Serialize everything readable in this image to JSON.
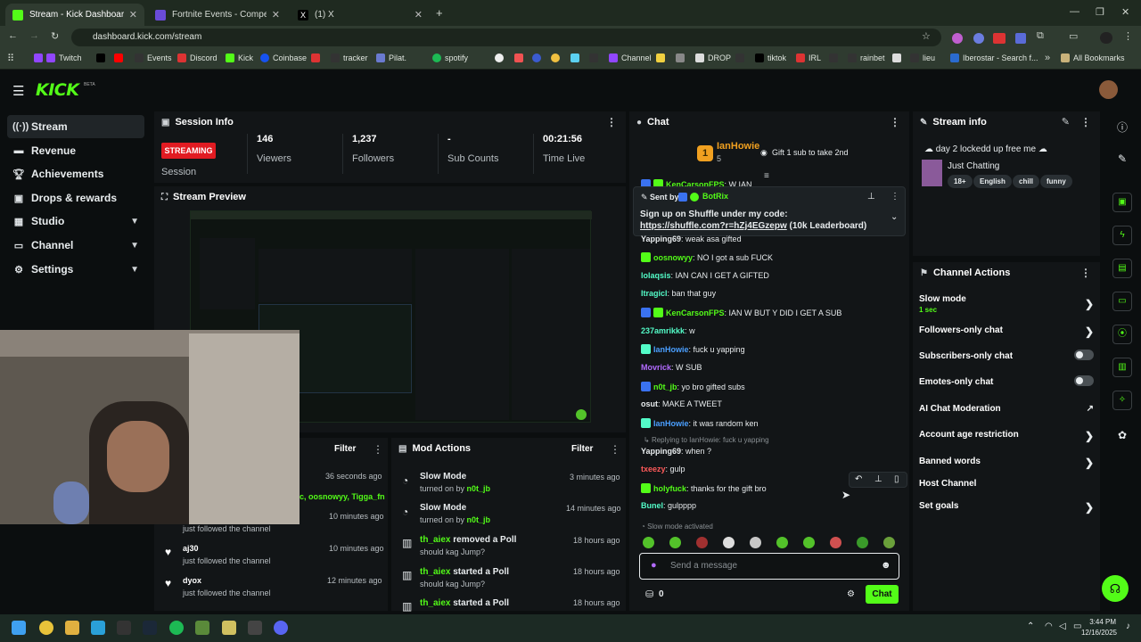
{
  "browser": {
    "tabs": [
      {
        "title": "Stream - Kick Dashboard",
        "color": "#53fc18"
      },
      {
        "title": "Fortnite Events - Competitive Tr",
        "color": "#6a4bd8"
      },
      {
        "title": "(1) X",
        "color": "#000000"
      }
    ],
    "url": "dashboard.kick.com/stream",
    "bookmarks": [
      "Twitch",
      "Events",
      "Discord",
      "Kick",
      "Coinbase",
      "tracker",
      "Pilat.",
      "spotify",
      "Channel",
      "DROP",
      "tiktok",
      "IRL",
      "rainbet",
      "lieu",
      "Iberostar - Search f...",
      "All Bookmarks"
    ]
  },
  "brand": {
    "logo": "KICK",
    "beta": "BETA",
    "accent": "#53fc18"
  },
  "sidebar": {
    "items": [
      {
        "label": "Stream",
        "icon": "broadcast-icon"
      },
      {
        "label": "Revenue",
        "icon": "wallet-icon"
      },
      {
        "label": "Achievements",
        "icon": "trophy-icon"
      },
      {
        "label": "Drops & rewards",
        "icon": "gift-icon"
      },
      {
        "label": "Studio",
        "icon": "studio-icon"
      },
      {
        "label": "Channel",
        "icon": "channel-icon"
      },
      {
        "label": "Settings",
        "icon": "gear-icon"
      }
    ]
  },
  "session": {
    "title": "Session Info",
    "status": "STREAMING",
    "status_label": "Session",
    "stats": [
      {
        "value": "146",
        "label": "Viewers"
      },
      {
        "value": "1,237",
        "label": "Followers"
      },
      {
        "value": "-",
        "label": "Sub Counts"
      },
      {
        "value": "00:21:56",
        "label": "Time Live"
      }
    ]
  },
  "preview": {
    "title": "Stream Preview"
  },
  "activity": {
    "filter": "Filter",
    "first_time": "36 seconds ago",
    "first_names": "c, oosnowyy, Tigga_fn",
    "items": [
      {
        "user": "",
        "action": "just followed the channel",
        "time": "10 minutes ago"
      },
      {
        "user": "aj30",
        "action": "just followed the channel",
        "time": "10 minutes ago"
      },
      {
        "user": "dyox",
        "action": "just followed the channel",
        "time": "12 minutes ago"
      }
    ]
  },
  "modactions": {
    "title": "Mod Actions",
    "filter": "Filter",
    "items": [
      {
        "title": "Slow Mode",
        "sub_prefix": "turned on by ",
        "sub_user": "n0t_jb",
        "time": "3 minutes ago"
      },
      {
        "title": "Slow Mode",
        "sub_prefix": "turned on by ",
        "sub_user": "n0t_jb",
        "time": "14 minutes ago"
      },
      {
        "title_user": "th_aiex",
        "title_rest": " removed a Poll",
        "sub": "should kag Jump?",
        "time": "18 hours ago"
      },
      {
        "title_user": "th_aiex",
        "title_rest": " started a Poll",
        "sub": "should kag Jump?",
        "time": "18 hours ago"
      },
      {
        "title_user": "th_aiex",
        "title_rest": " started a Poll",
        "sub": "",
        "time": "18 hours ago"
      }
    ]
  },
  "chat": {
    "title": "Chat",
    "top_gifter": "IanHowie",
    "top_rank": "1",
    "top_count": "5",
    "gift_msg": "Gift 1 sub to take 2nd",
    "pinned": {
      "sent_by": "Sent by",
      "user": "BotRix",
      "text": "Sign up on Shuffle under my code: ",
      "link": "https://shuffle.com?r=hZj4EGzepw",
      "suffix": " (10k Leaderboard)"
    },
    "messages": [
      {
        "user": "KenCarsonFPS",
        "text": "W IAN",
        "color": "#53fc18"
      },
      {
        "user": "Yapping69",
        "text": "weak asa gifted",
        "color": "#e8ecee"
      },
      {
        "user": "oosnowyy",
        "text": "NO I got a sub FUCK",
        "color": "#53fc18"
      },
      {
        "user": "lolaqsis",
        "text": "IAN CAN I GET A GIFTED",
        "color": "#53fcc8"
      },
      {
        "user": "Itragicl",
        "text": "ban that guy",
        "color": "#53fcc8"
      },
      {
        "user": "KenCarsonFPS",
        "text": "IAN W BUT Y DID I GET A SUB",
        "color": "#53fc18"
      },
      {
        "user": "237amrikkk",
        "text": "w",
        "color": "#53fcc8"
      },
      {
        "user": "IanHowie",
        "text": "fuck u yapping",
        "color": "#4a9fff"
      },
      {
        "user": "Movrick",
        "text": "W SUB",
        "color": "#b26bff"
      },
      {
        "user": "n0t_jb",
        "text": "yo bro gifted subs",
        "color": "#53fc18"
      },
      {
        "user": "osut",
        "text": "MAKE A TWEET",
        "color": "#e8ecee"
      },
      {
        "user": "IanHowie",
        "text": "it was random ken",
        "color": "#4a9fff"
      },
      {
        "user": "Yapping69",
        "text": "when ?",
        "color": "#e8ecee",
        "reply": "Replying to IanHowie: fuck u yapping"
      },
      {
        "user": "txeezy",
        "text": "gulp",
        "color": "#ff5a5a"
      },
      {
        "user": "holyfuck",
        "text": "thanks for the gift bro",
        "color": "#53fc18"
      },
      {
        "user": "Bunel",
        "text": "gulpppp",
        "color": "#53fcc8"
      }
    ],
    "slow_mode": "Slow mode activated",
    "placeholder": "Send a message",
    "points": "0",
    "send": "Chat"
  },
  "streaminfo": {
    "title": "Stream info",
    "stream_title": "day 2 lockedd up free me",
    "category": "Just Chatting",
    "tags": [
      "18+",
      "English",
      "chill",
      "funny"
    ]
  },
  "channelactions": {
    "title": "Channel Actions",
    "items": [
      {
        "label": "Slow mode",
        "sub": "1 sec",
        "control": "arrow"
      },
      {
        "label": "Followers-only chat",
        "control": "arrow"
      },
      {
        "label": "Subscribers-only chat",
        "control": "toggle"
      },
      {
        "label": "Emotes-only chat",
        "control": "toggle"
      },
      {
        "label": "AI Chat Moderation",
        "control": "external"
      },
      {
        "label": "Account age restriction",
        "control": "arrow"
      },
      {
        "label": "Banned words",
        "control": "arrow"
      },
      {
        "label": "Host Channel",
        "control": "none"
      },
      {
        "label": "Set goals",
        "control": "arrow"
      }
    ]
  },
  "taskbar": {
    "time": "3:44 PM",
    "date": "12/16/2025"
  }
}
